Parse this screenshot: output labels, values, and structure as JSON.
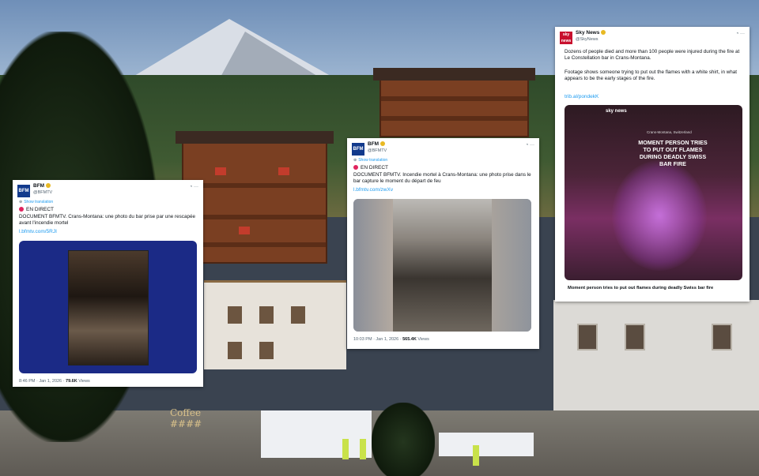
{
  "background": {
    "bar_sign": "Coffee ####"
  },
  "tweets": [
    {
      "name": "BFM",
      "handle": "@BFMTV",
      "avatar_text": "BFM",
      "show_translation": "Show translation",
      "live": "EN DIRECT",
      "body": "DOCUMENT BFMTV. Crans-Montana: une photo du bar prise par une rescapée avant l'incendie mortel",
      "link": "l.bfmtv.com/5RJI",
      "time": "8:46 PM · Jan 1, 2026 ·",
      "views_count": "79.6K",
      "views_label": "Views"
    },
    {
      "name": "BFM",
      "handle": "@BFMTV",
      "avatar_text": "BFM",
      "show_translation": "Show translation",
      "live": "EN DIRECT",
      "body": "DOCUMENT BFMTV. Incendie mortel à Crans-Montana: une photo prise dans le bar capture le moment du départ de feu",
      "link": "l.bfmtv.com/zwXv",
      "time": "10:03 PM · Jan 1, 2026 ·",
      "views_count": "565.4K",
      "views_label": "Views"
    },
    {
      "name": "Sky News",
      "handle": "@SkyNews",
      "avatar_text": "sky news",
      "body1": "Dozens of people died and more than 100 people were injured during the fire at Le Constellation bar in Crans-Montana.",
      "body2": "Footage shows someone trying to put out the flames with a white shirt, in what appears to be the early stages of the fire.",
      "link": "trib.al/pondekK",
      "video_logo": "sky news",
      "video_location": "Crans-Montana, Switzerland",
      "video_headline": "MOMENT PERSON TRIES TO PUT OUT FLAMES DURING DEADLY SWISS BAR FIRE",
      "caption": "Moment person tries to put out flames during deadly Swiss bar fire"
    }
  ]
}
